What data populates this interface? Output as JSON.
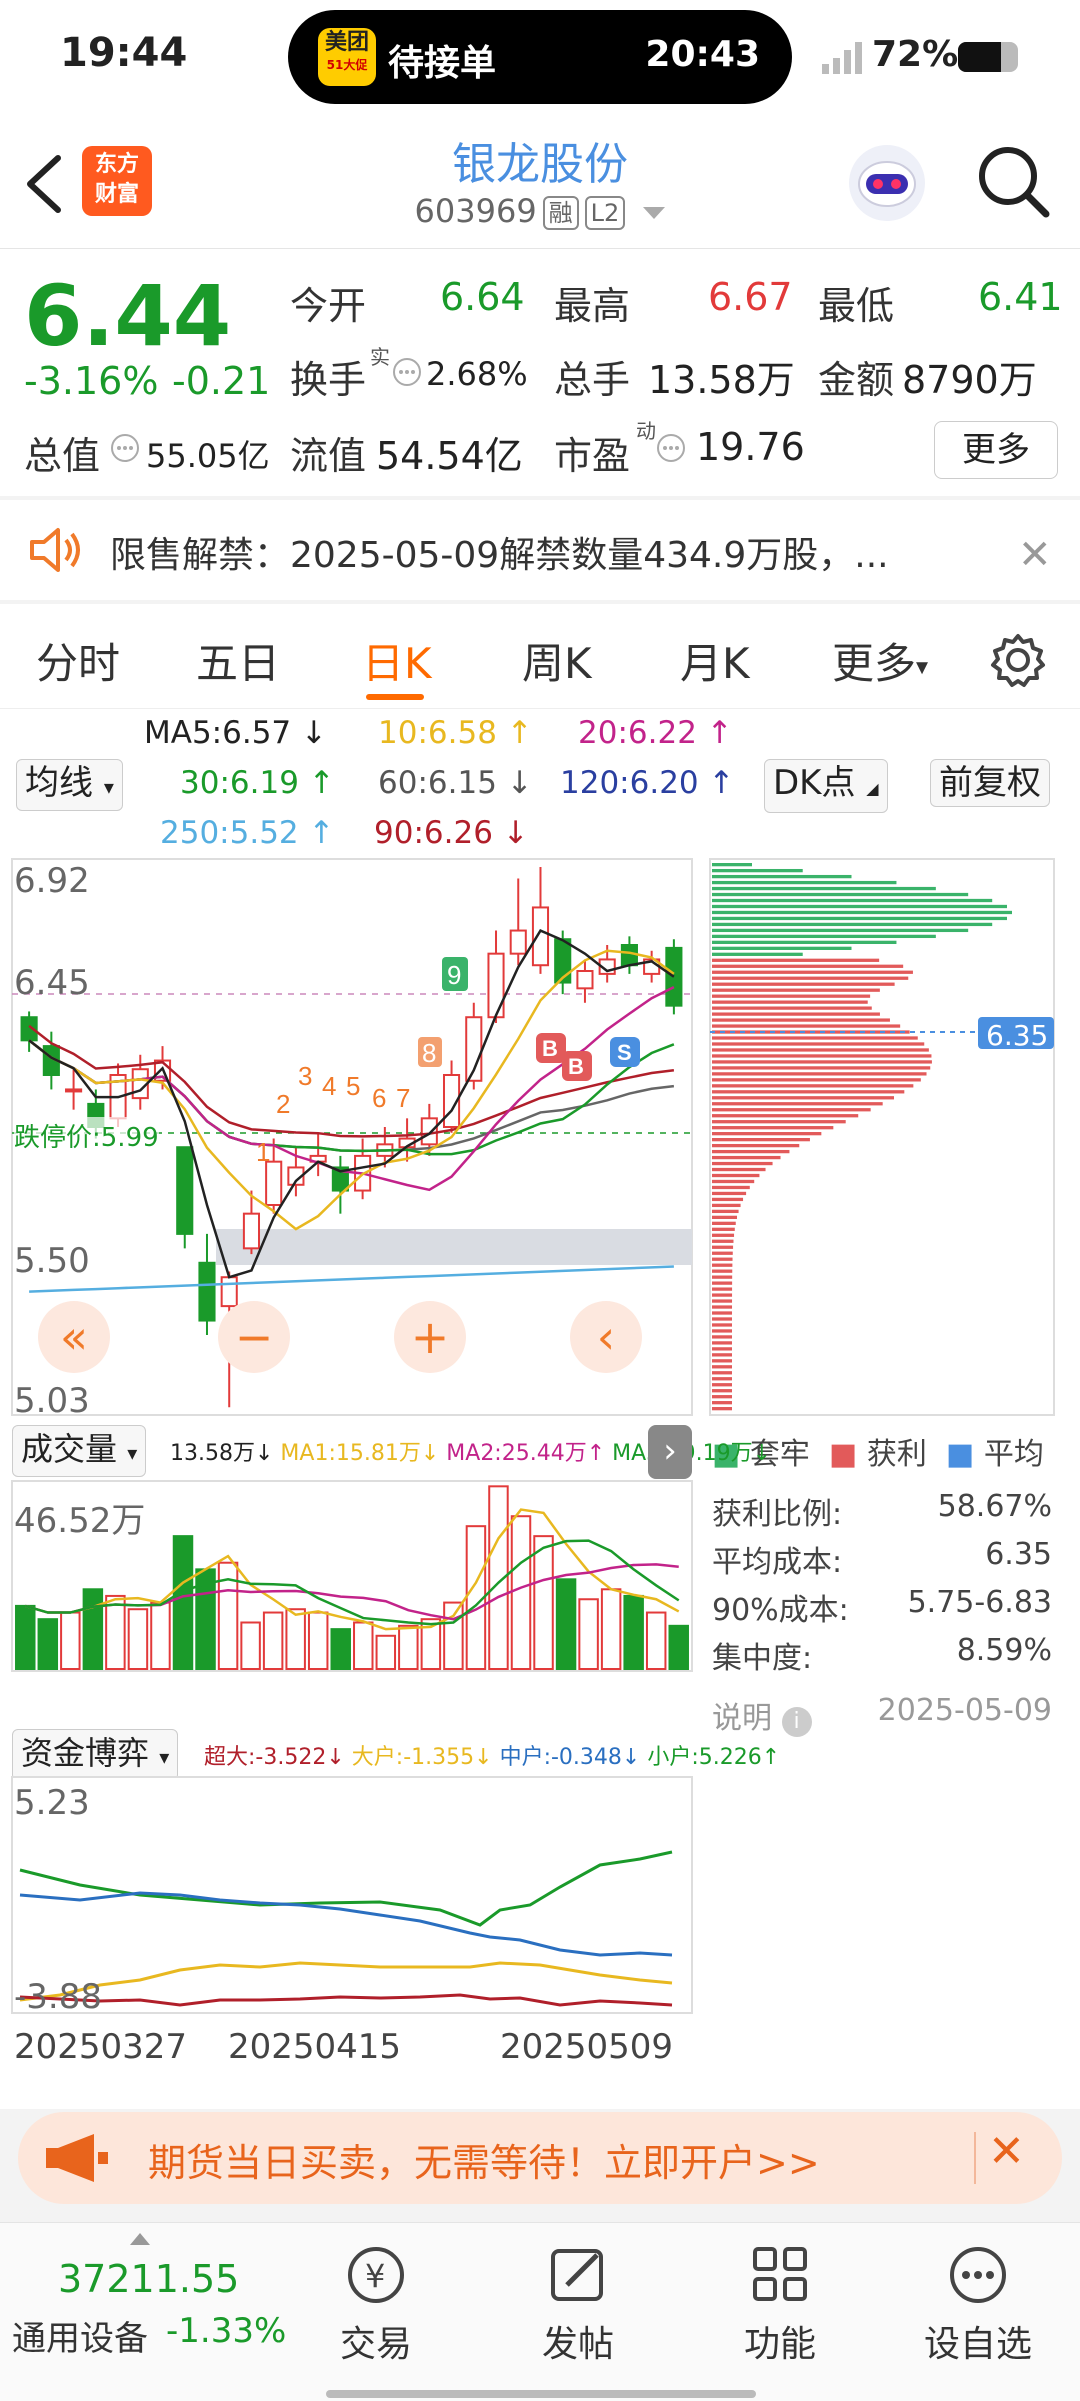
{
  "status_bar": {
    "time": "19:44",
    "pill_app": "美团",
    "pill_app_sub": "51大促",
    "pill_label": "待接单",
    "pill_time": "20:43",
    "battery": "72%",
    "battery_level": 0.72
  },
  "header": {
    "brand": [
      "东方",
      "财富"
    ],
    "stock_name": "银龙股份",
    "stock_code": "603969",
    "tag_margin": "融",
    "tag_level": "L2"
  },
  "quote": {
    "price": "6.44",
    "change_pct": "-3.16%",
    "change": "-0.21",
    "open_label": "今开",
    "open": "6.64",
    "high_label": "最高",
    "high": "6.67",
    "low_label": "最低",
    "low": "6.41",
    "turnover_label": "换手",
    "turnover_sup": "实",
    "turnover": "2.68%",
    "volume_label": "总手",
    "volume": "13.58万",
    "amount_label": "金额",
    "amount": "8790万",
    "mcap_label": "总值",
    "mcap": "55.05亿",
    "float_label": "流值",
    "float": "54.54亿",
    "pe_label": "市盈",
    "pe_sup": "动",
    "pe": "19.76",
    "more": "更多"
  },
  "notice": {
    "text": "限售解禁：2025-05-09解禁数量434.9万股，..."
  },
  "tabs": [
    "分时",
    "五日",
    "日K",
    "周K",
    "月K",
    "更多"
  ],
  "active_tab": 2,
  "ma": {
    "selector": "均线",
    "ma5": "MA5:6.57 ↓",
    "ma10": "10:6.58 ↑",
    "ma20": "20:6.22 ↑",
    "ma30": "30:6.19 ↑",
    "ma60": "60:6.15 ↓",
    "ma120": "120:6.20 ↑",
    "ma250": "250:5.52 ↑",
    "ma90": "90:6.26 ↓",
    "dk": "DK点",
    "fq": "前复权"
  },
  "chart_labels": {
    "y_top": "6.92",
    "y_mid": "6.45",
    "y_50": "5.50",
    "y_bottom": "5.03",
    "limit_down": "跌停价:5.99",
    "cost_tag": "6.35",
    "volume_selector": "成交量",
    "vol_v": "13.58万↓",
    "vol_ma1": "MA1:15.81万↓",
    "vol_ma2": "MA2:25.44万↑",
    "vol_ma3": "MA3:19.19万↓",
    "vol_max": "46.52万",
    "fund_selector": "资金博弈",
    "fund_super": "超大:-3.522↓",
    "fund_large": "大户:-1.355↓",
    "fund_mid": "中户:-0.348↓",
    "fund_small": "小户:5.226↑",
    "fund_top": "5.23",
    "fund_bottom": "-3.88",
    "date1": "20250327",
    "date2": "20250415",
    "date3": "20250509"
  },
  "chart_data": {
    "type": "candlestick",
    "ylim": [
      5.03,
      6.92
    ],
    "candles": [
      {
        "o": 6.4,
        "c": 6.32,
        "h": 6.42,
        "l": 6.28
      },
      {
        "o": 6.3,
        "c": 6.2,
        "h": 6.35,
        "l": 6.15
      },
      {
        "o": 6.15,
        "c": 6.15,
        "h": 6.22,
        "l": 6.08
      },
      {
        "o": 6.1,
        "c": 6.02,
        "h": 6.15,
        "l": 5.98
      },
      {
        "o": 6.05,
        "c": 6.2,
        "h": 6.24,
        "l": 6.02
      },
      {
        "o": 6.12,
        "c": 6.22,
        "h": 6.27,
        "l": 6.08
      },
      {
        "o": 6.18,
        "c": 6.25,
        "h": 6.3,
        "l": 6.15
      },
      {
        "o": 5.95,
        "c": 5.65,
        "h": 5.95,
        "l": 5.6
      },
      {
        "o": 5.55,
        "c": 5.35,
        "h": 5.65,
        "l": 5.3
      },
      {
        "o": 5.4,
        "c": 5.5,
        "h": 5.52,
        "l": 5.05
      },
      {
        "o": 5.6,
        "c": 5.72,
        "h": 5.8,
        "l": 5.58
      },
      {
        "o": 5.75,
        "c": 5.9,
        "h": 5.98,
        "l": 5.72
      },
      {
        "o": 5.82,
        "c": 5.88,
        "h": 5.95,
        "l": 5.78
      },
      {
        "o": 5.9,
        "c": 5.92,
        "h": 6.0,
        "l": 5.85
      },
      {
        "o": 5.88,
        "c": 5.8,
        "h": 5.92,
        "l": 5.72
      },
      {
        "o": 5.8,
        "c": 5.92,
        "h": 5.98,
        "l": 5.77
      },
      {
        "o": 5.92,
        "c": 5.96,
        "h": 6.02,
        "l": 5.88
      },
      {
        "o": 5.95,
        "c": 5.98,
        "h": 6.05,
        "l": 5.9
      },
      {
        "o": 5.96,
        "c": 6.05,
        "h": 6.1,
        "l": 5.92
      },
      {
        "o": 6.02,
        "c": 6.2,
        "h": 6.25,
        "l": 6.0
      },
      {
        "o": 6.18,
        "c": 6.4,
        "h": 6.45,
        "l": 6.15
      },
      {
        "o": 6.4,
        "c": 6.62,
        "h": 6.7,
        "l": 6.38
      },
      {
        "o": 6.62,
        "c": 6.7,
        "h": 6.88,
        "l": 6.58
      },
      {
        "o": 6.58,
        "c": 6.78,
        "h": 6.92,
        "l": 6.55
      },
      {
        "o": 6.67,
        "c": 6.52,
        "h": 6.7,
        "l": 6.48
      },
      {
        "o": 6.5,
        "c": 6.56,
        "h": 6.6,
        "l": 6.45
      },
      {
        "o": 6.55,
        "c": 6.6,
        "h": 6.65,
        "l": 6.52
      },
      {
        "o": 6.65,
        "c": 6.58,
        "h": 6.68,
        "l": 6.55
      },
      {
        "o": 6.55,
        "c": 6.6,
        "h": 6.63,
        "l": 6.52
      },
      {
        "o": 6.64,
        "c": 6.44,
        "h": 6.67,
        "l": 6.41
      }
    ],
    "volumes": [
      19,
      15,
      17,
      24,
      22,
      18,
      20,
      40,
      30,
      32,
      14,
      17,
      18,
      17,
      12,
      14,
      10,
      13,
      15,
      20,
      43,
      55,
      46,
      40,
      27,
      21,
      24,
      22,
      17,
      13
    ],
    "chip_legend": [
      "套牢",
      "获利",
      "平均"
    ],
    "chip_stats": [
      {
        "label": "获利比例:",
        "value": "58.67%"
      },
      {
        "label": "平均成本:",
        "value": "6.35"
      },
      {
        "label": "90%成本:",
        "value": "5.75-6.83"
      },
      {
        "label": "集中度:",
        "value": "8.59%"
      }
    ],
    "chip_note": "说明",
    "chip_date": "2025-05-09"
  },
  "ad": {
    "text": "期货当日买卖，无需等待！立即开户>>"
  },
  "bottom_nav": {
    "index_value": "37211.55",
    "index_name": "通用设备",
    "index_change": "-1.33%",
    "items": [
      "交易",
      "发帖",
      "功能",
      "设自选"
    ]
  },
  "colors": {
    "up": "#e23a3a",
    "down": "#1a9a2a",
    "accent": "#ff6a00",
    "link": "#4a8fe0"
  }
}
